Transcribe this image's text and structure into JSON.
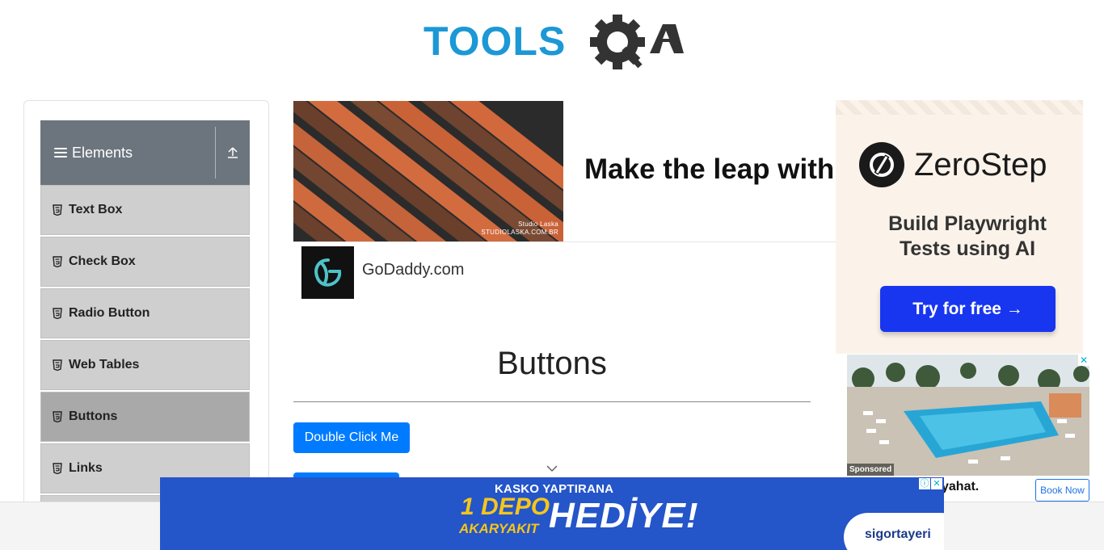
{
  "header": {
    "logo_text": "TOOLSQA"
  },
  "sidebar": {
    "group_title": "Elements",
    "items": [
      {
        "label": "Text Box",
        "active": false
      },
      {
        "label": "Check Box",
        "active": false
      },
      {
        "label": "Radio Button",
        "active": false
      },
      {
        "label": "Web Tables",
        "active": false
      },
      {
        "label": "Buttons",
        "active": true
      },
      {
        "label": "Links",
        "active": false
      }
    ]
  },
  "ad_top": {
    "image_credit_line1": "Studio Laska",
    "image_credit_line2": "STUDIOLASKA.COM.BR",
    "headline": "Make the leap with",
    "advertiser": "GoDaddy.com"
  },
  "main": {
    "title": "Buttons",
    "double_click_label": "Double Click Me"
  },
  "right_ad": {
    "brand": "ZeroStep",
    "tagline_line1": "Build Playwright",
    "tagline_line2": "Tests using AI",
    "cta": "Try for free →"
  },
  "hotel_ad": {
    "sponsored": "Sponsored",
    "caption": "yahat.",
    "book_label": "Book Now"
  },
  "bottom_ad": {
    "line1": "KASKO YAPTIRANA",
    "line2": "1 DEPO",
    "line3": "AKARYAKIT",
    "line4": "HEDİYE!",
    "brand": "sigortayeri"
  },
  "colors": {
    "logo_blue": "#1b98d5",
    "logo_dark": "#333333",
    "sidebar_header": "#6c757d",
    "sidebar_item": "#cfcfcf",
    "sidebar_item_active": "#a9a9a9",
    "primary_button": "#007bff",
    "zerostep_button": "#1836f0",
    "bottom_ad_bg": "#2455c9"
  }
}
